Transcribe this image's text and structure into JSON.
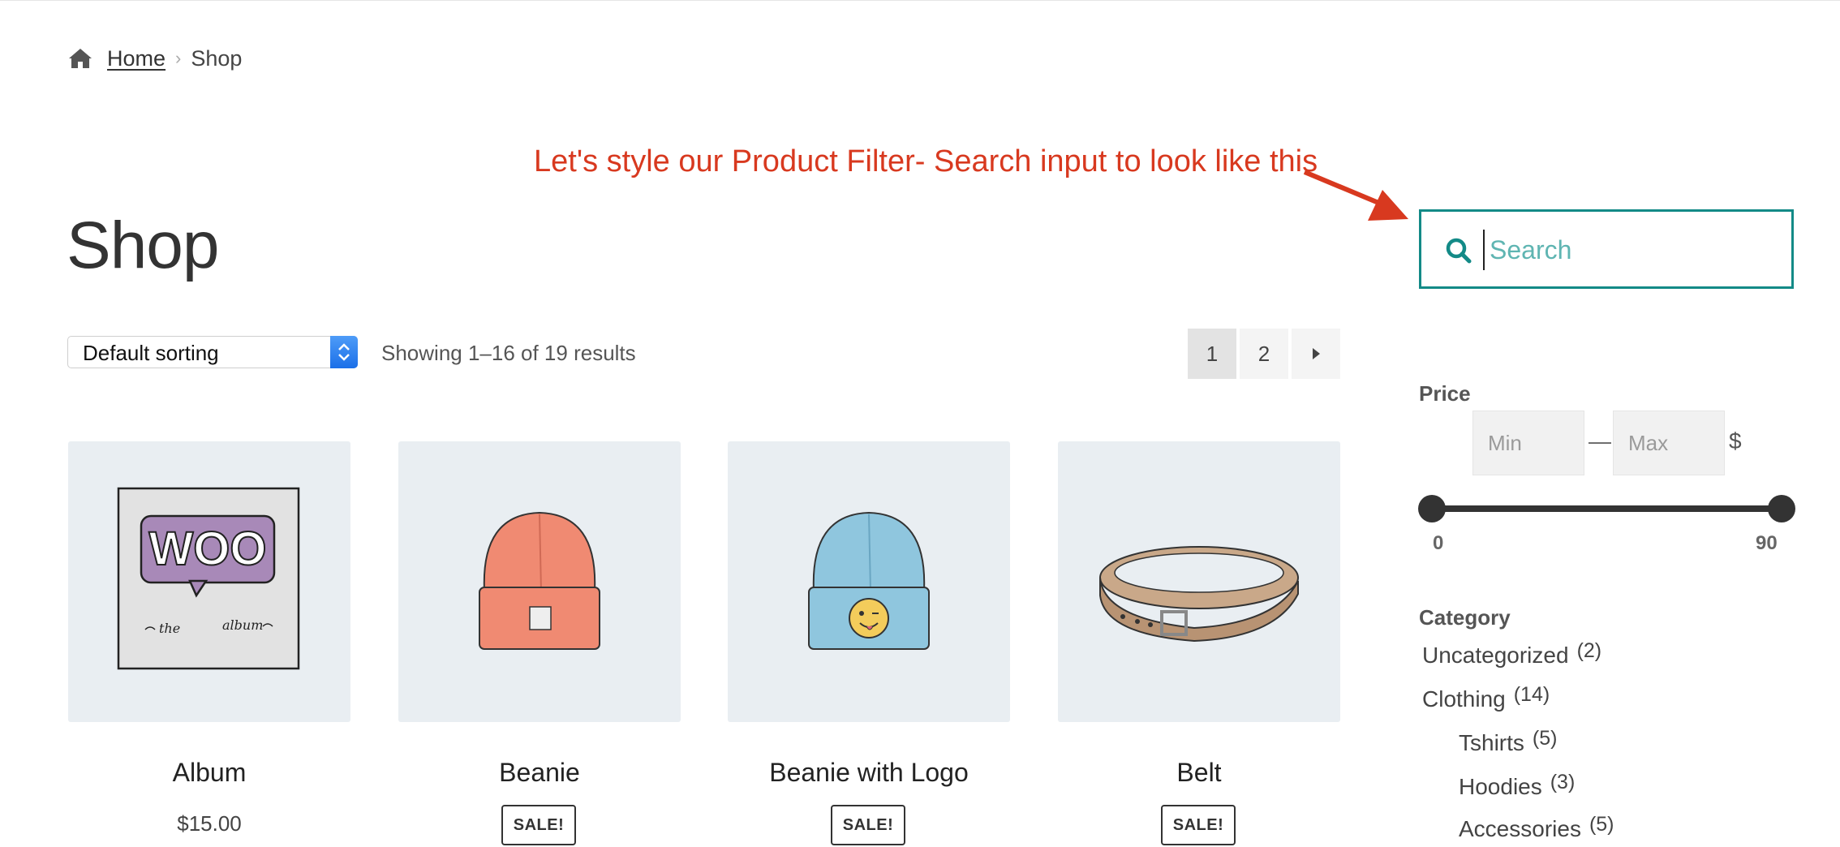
{
  "breadcrumb": {
    "home_label": "Home",
    "current": "Shop",
    "separator": "›"
  },
  "annotation": {
    "text": "Let's style our Product Filter- Search input to look like this",
    "color": "#d8391f"
  },
  "page": {
    "title": "Shop"
  },
  "toolbar": {
    "sort_selected": "Default sorting",
    "result_count": "Showing 1–16 of 19 results",
    "pagination": {
      "pages": [
        "1",
        "2"
      ],
      "current": "1",
      "next_icon": "caret-right-icon"
    }
  },
  "products": [
    {
      "name": "Album",
      "price": "$15.00",
      "badge": ""
    },
    {
      "name": "Beanie",
      "price": "",
      "badge": "SALE!"
    },
    {
      "name": "Beanie with Logo",
      "price": "",
      "badge": "SALE!"
    },
    {
      "name": "Belt",
      "price": "",
      "badge": "SALE!"
    }
  ],
  "sidebar": {
    "search": {
      "placeholder": "Search",
      "value": "",
      "accent": "#138a87"
    },
    "price": {
      "title": "Price",
      "min_placeholder": "Min",
      "max_placeholder": "Max",
      "separator": "—",
      "currency": "$",
      "range_min": "0",
      "range_max": "90"
    },
    "category": {
      "title": "Category",
      "items": [
        {
          "label": "Uncategorized",
          "count": "(2)",
          "level": 0
        },
        {
          "label": "Clothing",
          "count": "(14)",
          "level": 0
        },
        {
          "label": "Tshirts",
          "count": "(5)",
          "level": 1
        },
        {
          "label": "Hoodies",
          "count": "(3)",
          "level": 1
        },
        {
          "label": "Accessories",
          "count": "(5)",
          "level": 1
        }
      ]
    }
  }
}
